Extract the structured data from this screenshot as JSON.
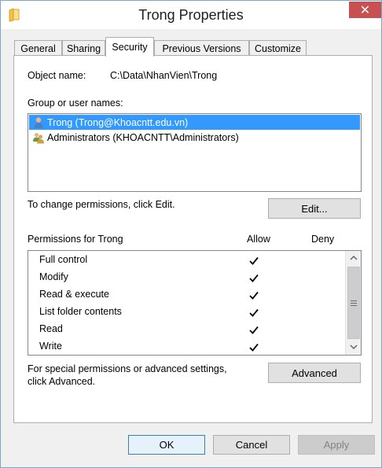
{
  "window": {
    "title": "Trong Properties",
    "close_glyph": "✕"
  },
  "tabs": [
    {
      "label": "General"
    },
    {
      "label": "Sharing"
    },
    {
      "label": "Security",
      "active": true
    },
    {
      "label": "Previous Versions"
    },
    {
      "label": "Customize"
    }
  ],
  "security": {
    "object_name_label": "Object name:",
    "object_name_value": "C:\\Data\\NhanVien\\Trong",
    "group_label": "Group or user names:",
    "principals": [
      {
        "name": "Trong (Trong@Khoacntt.edu.vn)",
        "icon": "user-icon",
        "selected": true
      },
      {
        "name": "Administrators (KHOACNTT\\Administrators)",
        "icon": "group-icon",
        "selected": false
      }
    ],
    "change_text": "To change permissions, click Edit.",
    "edit_button": "Edit...",
    "permissions_for": "Permissions for Trong",
    "allow_header": "Allow",
    "deny_header": "Deny",
    "permissions": [
      {
        "name": "Full control",
        "allow": true,
        "deny": false
      },
      {
        "name": "Modify",
        "allow": true,
        "deny": false
      },
      {
        "name": "Read & execute",
        "allow": true,
        "deny": false
      },
      {
        "name": "List folder contents",
        "allow": true,
        "deny": false
      },
      {
        "name": "Read",
        "allow": true,
        "deny": false
      },
      {
        "name": "Write",
        "allow": true,
        "deny": false
      }
    ],
    "special_text_line1": "For special permissions or advanced settings,",
    "special_text_line2": "click Advanced.",
    "advanced_button": "Advanced"
  },
  "footer": {
    "ok": "OK",
    "cancel": "Cancel",
    "apply": "Apply"
  },
  "colors": {
    "selection": "#3399ff",
    "close_button": "#c75050"
  }
}
